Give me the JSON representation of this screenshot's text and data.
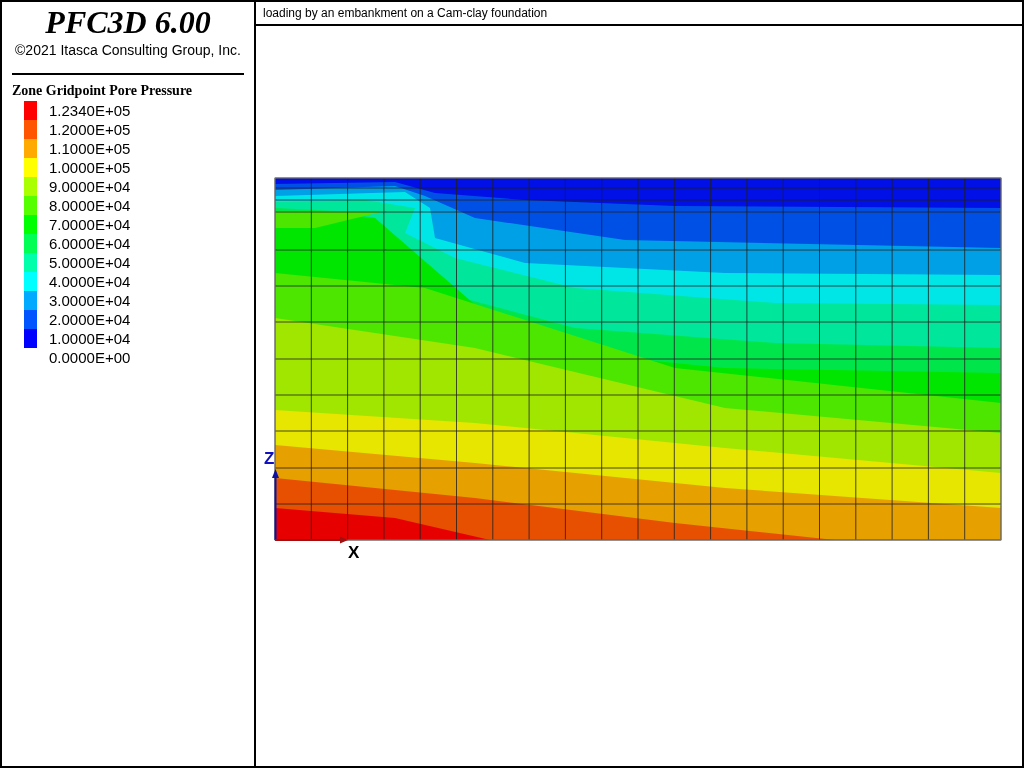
{
  "header": {
    "title": "PFC3D 6.00",
    "copyright": "©2021 Itasca Consulting Group, Inc."
  },
  "legend": {
    "title": "Zone Gridpoint Pore Pressure",
    "items": [
      {
        "label": "1.2340E+05",
        "color": "#ff0000"
      },
      {
        "label": "1.2000E+05",
        "color": "#ff5500"
      },
      {
        "label": "1.1000E+05",
        "color": "#ffaa00"
      },
      {
        "label": "1.0000E+05",
        "color": "#ffff00"
      },
      {
        "label": "9.0000E+04",
        "color": "#aaff00"
      },
      {
        "label": "8.0000E+04",
        "color": "#55ff00"
      },
      {
        "label": "7.0000E+04",
        "color": "#00ff00"
      },
      {
        "label": "6.0000E+04",
        "color": "#00ff55"
      },
      {
        "label": "5.0000E+04",
        "color": "#00ffaa"
      },
      {
        "label": "4.0000E+04",
        "color": "#00ffff"
      },
      {
        "label": "3.0000E+04",
        "color": "#00aaff"
      },
      {
        "label": "2.0000E+04",
        "color": "#0055ff"
      },
      {
        "label": "1.0000E+04",
        "color": "#0000ff"
      },
      {
        "label": "0.0000E+00"
      }
    ]
  },
  "plot": {
    "title": "loading by an embankment on a Cam-clay foundation",
    "axis_z": "Z",
    "axis_x": "X"
  }
}
